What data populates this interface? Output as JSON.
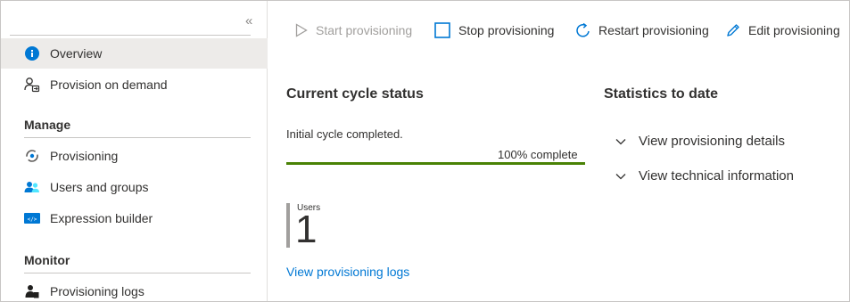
{
  "sidebar": {
    "collapse_glyph": "«",
    "items_top": [
      {
        "label": "Overview",
        "icon": "info-icon",
        "active": true
      },
      {
        "label": "Provision on demand",
        "icon": "person-sync-icon",
        "active": false
      }
    ],
    "manage": {
      "heading": "Manage",
      "items": [
        {
          "label": "Provisioning",
          "icon": "provisioning-icon"
        },
        {
          "label": "Users and groups",
          "icon": "users-groups-icon"
        },
        {
          "label": "Expression builder",
          "icon": "expression-builder-icon"
        }
      ]
    },
    "monitor": {
      "heading": "Monitor",
      "items": [
        {
          "label": "Provisioning logs",
          "icon": "person-log-icon"
        }
      ]
    }
  },
  "toolbar": {
    "start": {
      "label": "Start provisioning",
      "icon": "play-icon",
      "disabled": true
    },
    "stop": {
      "label": "Stop provisioning",
      "icon": "stop-square-icon"
    },
    "restart": {
      "label": "Restart provisioning",
      "icon": "restart-icon"
    },
    "edit": {
      "label": "Edit provisioning",
      "icon": "pencil-icon"
    }
  },
  "current_cycle": {
    "heading": "Current cycle status",
    "status": "Initial cycle completed.",
    "percent_label": "100% complete",
    "progress": 1.0,
    "progress_color": "#498205",
    "users_label": "Users",
    "users_value": "1",
    "logs_link": "View provisioning logs"
  },
  "statistics": {
    "heading": "Statistics to date",
    "expanders": [
      {
        "label": "View provisioning details"
      },
      {
        "label": "View technical information"
      }
    ]
  },
  "colors": {
    "accent": "#0078d4",
    "active_bg": "#edebe9",
    "progress": "#498205"
  }
}
